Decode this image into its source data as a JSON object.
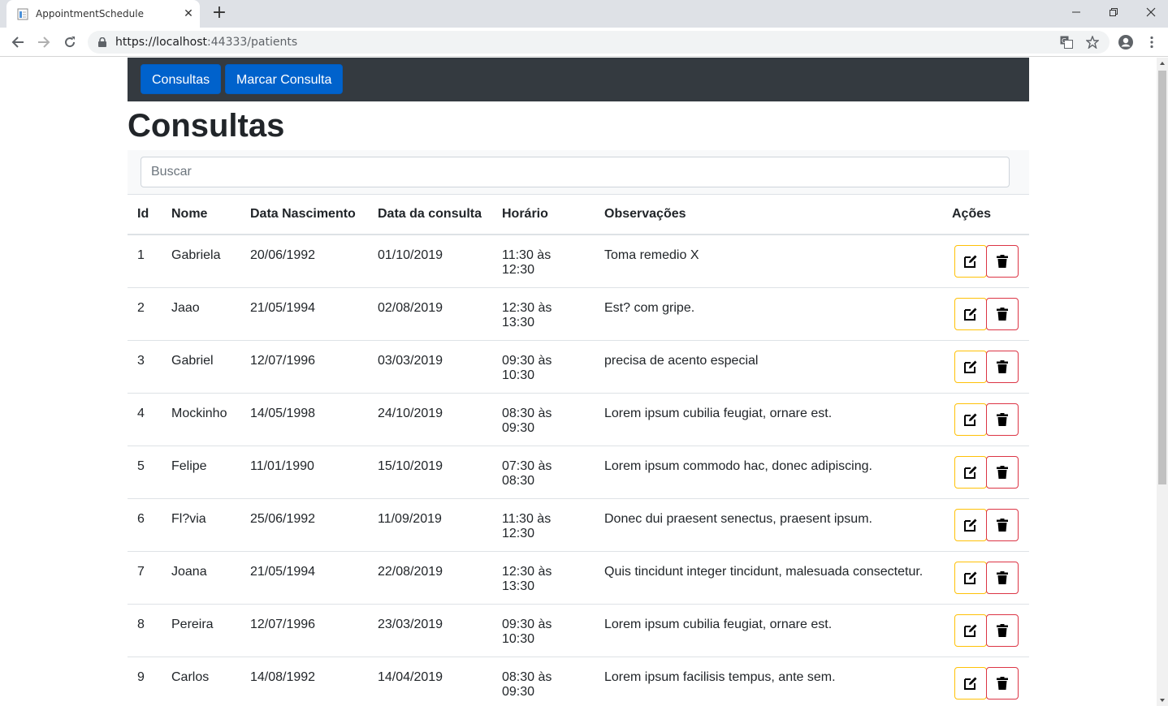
{
  "browser": {
    "tab_title": "AppointmentSchedule",
    "url_host": "https://localhost",
    "url_rest": ":44333/patients"
  },
  "nav": {
    "consultas_label": "Consultas",
    "marcar_label": "Marcar Consulta"
  },
  "page_title": "Consultas",
  "search": {
    "placeholder": "Buscar"
  },
  "table": {
    "headers": [
      "Id",
      "Nome",
      "Data Nascimento",
      "Data da consulta",
      "Horário",
      "Observações",
      "Ações"
    ],
    "rows": [
      [
        "1",
        "Gabriela",
        "20/06/1992",
        "01/10/2019",
        "11:30 às 12:30",
        "Toma remedio X"
      ],
      [
        "2",
        "Jaao",
        "21/05/1994",
        "02/08/2019",
        "12:30 às 13:30",
        "Est? com gripe."
      ],
      [
        "3",
        "Gabriel",
        "12/07/1996",
        "03/03/2019",
        "09:30 às 10:30",
        "precisa de acento especial"
      ],
      [
        "4",
        "Mockinho",
        "14/05/1998",
        "24/10/2019",
        "08:30 às 09:30",
        "Lorem ipsum cubilia feugiat, ornare est."
      ],
      [
        "5",
        "Felipe",
        "11/01/1990",
        "15/10/2019",
        "07:30 às 08:30",
        "Lorem ipsum commodo hac, donec adipiscing."
      ],
      [
        "6",
        "Fl?via",
        "25/06/1992",
        "11/09/2019",
        "11:30 às 12:30",
        "Donec dui praesent senectus, praesent ipsum."
      ],
      [
        "7",
        "Joana",
        "21/05/1994",
        "22/08/2019",
        "12:30 às 13:30",
        "Quis tincidunt integer tincidunt, malesuada consectetur."
      ],
      [
        "8",
        "Pereira",
        "12/07/1996",
        "23/03/2019",
        "09:30 às 10:30",
        "Lorem ipsum cubilia feugiat, ornare est."
      ],
      [
        "9",
        "Carlos",
        "14/08/1992",
        "14/04/2019",
        "08:30 às 09:30",
        "Lorem ipsum facilisis tempus, ante sem."
      ]
    ]
  },
  "colors": {
    "navbar": "#343a40",
    "primary_button": "#0062cc",
    "edit_border": "#ffc107",
    "delete_border": "#dc3545"
  }
}
